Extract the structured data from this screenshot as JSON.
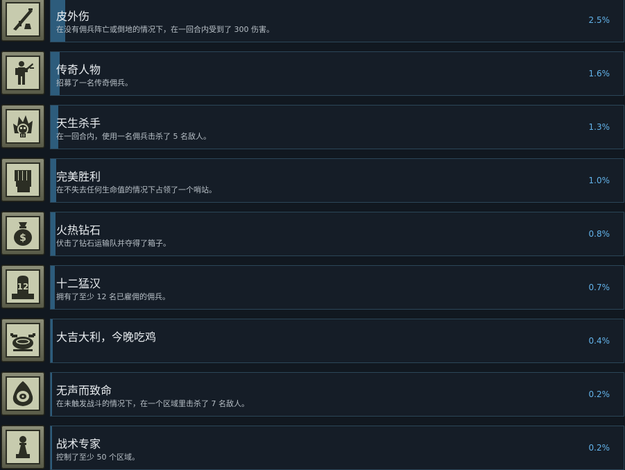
{
  "achievements": [
    {
      "title": "皮外伤",
      "desc": "在没有佣兵阵亡或倒地的情况下，在一回合内受到了 300 伤害。",
      "percent_label": "2.5%",
      "percent": 2.5,
      "icon": "rifle-icon"
    },
    {
      "title": "传奇人物",
      "desc": "招募了一名传奇佣兵。",
      "percent_label": "1.6%",
      "percent": 1.6,
      "icon": "soldier-icon"
    },
    {
      "title": "天生杀手",
      "desc": "在一回合内，使用一名佣兵击杀了 5 名敌人。",
      "percent_label": "1.3%",
      "percent": 1.3,
      "icon": "flaming-skull-icon"
    },
    {
      "title": "完美胜利",
      "desc": "在不失去任何生命值的情况下占领了一个哨站。",
      "percent_label": "1.0%",
      "percent": 1.0,
      "icon": "fist-icon"
    },
    {
      "title": "火热钻石",
      "desc": "伏击了钻石运输队并夺得了箱子。",
      "percent_label": "0.8%",
      "percent": 0.8,
      "icon": "money-bag-icon"
    },
    {
      "title": "十二猛汉",
      "desc": "拥有了至少 12 名已雇佣的佣兵。",
      "percent_label": "0.7%",
      "percent": 0.7,
      "icon": "monument-icon"
    },
    {
      "title": "大吉大利，今晚吃鸡",
      "desc": "",
      "percent_label": "0.4%",
      "percent": 0.4,
      "icon": "roast-chicken-icon"
    },
    {
      "title": "无声而致命",
      "desc": "在未触发战斗的情况下，在一个区域里击杀了 7 名敌人。",
      "percent_label": "0.2%",
      "percent": 0.2,
      "icon": "hooded-eye-icon"
    },
    {
      "title": "战术专家",
      "desc": "控制了至少 50 个区域。",
      "percent_label": "0.2%",
      "percent": 0.2,
      "icon": "chess-pawn-icon"
    }
  ],
  "colors": {
    "bar": "#2d5c7c",
    "percent": "#63b3ea",
    "card_border": "#2b4658",
    "icon_ink": "#2c2e24"
  }
}
